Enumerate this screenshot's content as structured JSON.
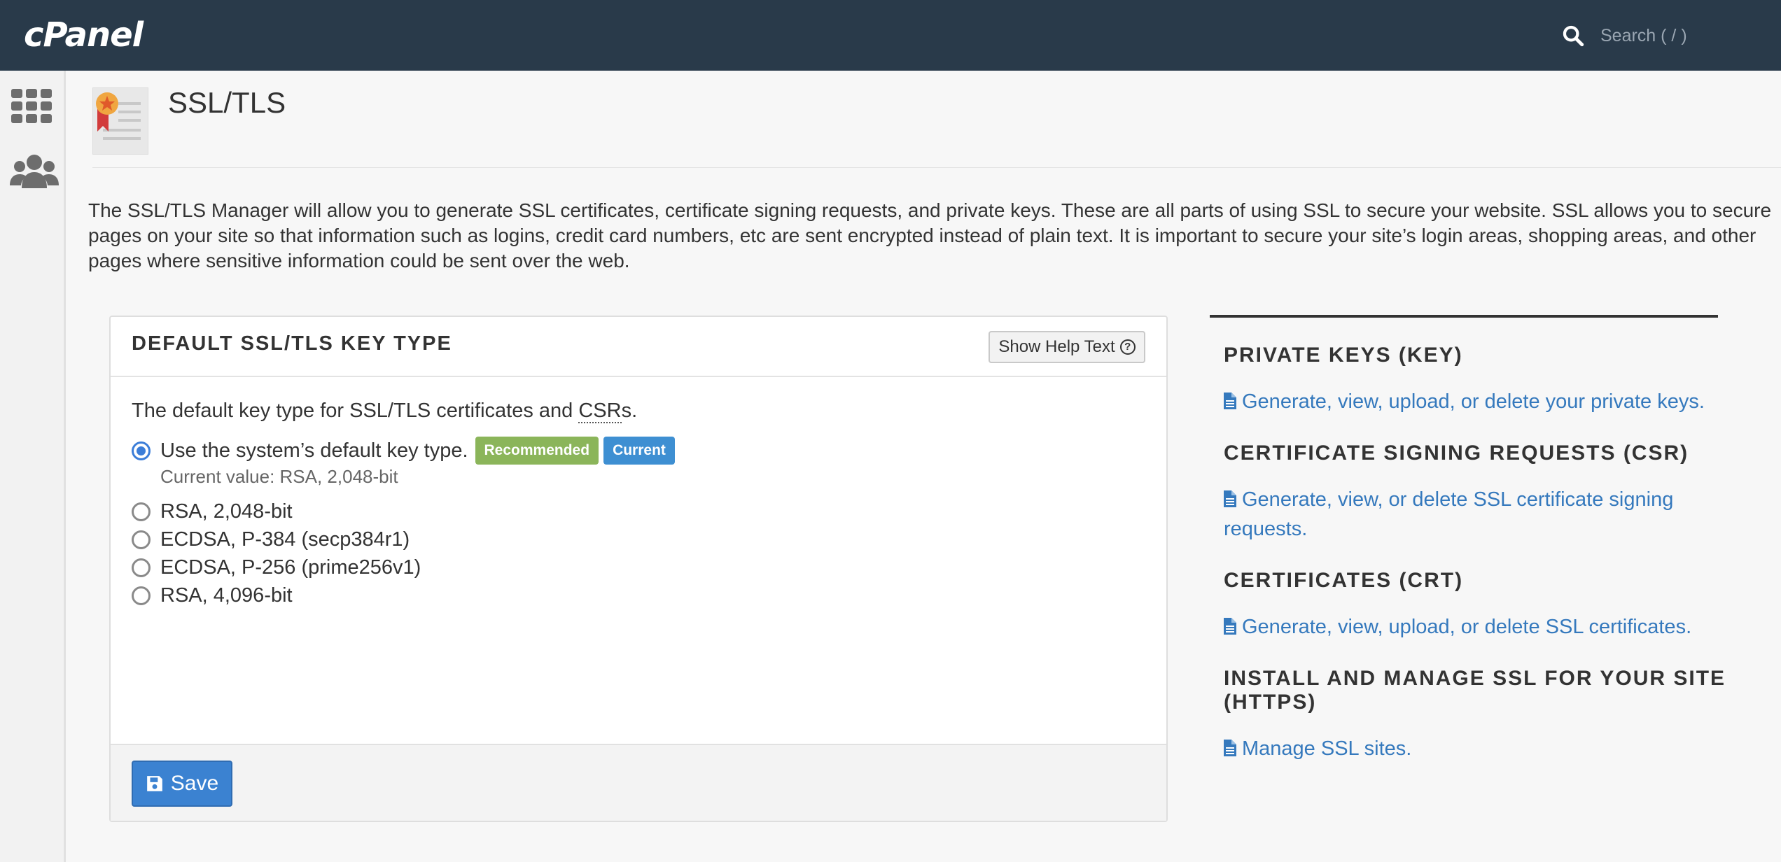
{
  "header": {
    "logo": "cPanel",
    "search_placeholder": "Search ( / )"
  },
  "sidebar": {
    "items": [
      {
        "icon": "grid-icon"
      },
      {
        "icon": "users-icon"
      }
    ]
  },
  "page": {
    "title": "SSL/TLS",
    "intro": "The SSL/TLS Manager will allow you to generate SSL certificates, certificate signing requests, and private keys. These are all parts of using SSL to secure your website. SSL allows you to secure pages on your site so that information such as logins, credit card numbers, etc are sent encrypted instead of plain text. It is important to secure your site’s login areas, shopping areas, and other pages where sensitive information could be sent over the web."
  },
  "key_type_card": {
    "title": "DEFAULT SSL/TLS KEY TYPE",
    "help_button": "Show Help Text",
    "description_before": "The default key type for SSL/TLS certificates and ",
    "description_abbr": "CSR",
    "description_after": "s.",
    "options": [
      {
        "label": "Use the system’s default key type.",
        "checked": true
      },
      {
        "label": "RSA, 2,048-bit",
        "checked": false
      },
      {
        "label": "ECDSA, P-384 (secp384r1)",
        "checked": false
      },
      {
        "label": "ECDSA, P-256 (prime256v1)",
        "checked": false
      },
      {
        "label": "RSA, 4,096-bit",
        "checked": false
      }
    ],
    "badge_recommended": "Recommended",
    "badge_current": "Current",
    "current_value": "Current value: RSA, 2,048-bit",
    "save_label": "Save",
    "colors": {
      "recommended": "#8bb55a",
      "current": "#3e8fd2",
      "save": "#3b82d1"
    }
  },
  "right_panel": {
    "sections": [
      {
        "heading": "PRIVATE KEYS (KEY)",
        "link": "Generate, view, upload, or delete your private keys."
      },
      {
        "heading": "CERTIFICATE SIGNING REQUESTS (CSR)",
        "link": "Generate, view, or delete SSL certificate signing requests."
      },
      {
        "heading": "CERTIFICATES (CRT)",
        "link": "Generate, view, upload, or delete SSL certificates."
      },
      {
        "heading": "INSTALL AND MANAGE SSL FOR YOUR SITE (HTTPS)",
        "link": "Manage SSL sites."
      }
    ],
    "link_color": "#3579bd"
  }
}
